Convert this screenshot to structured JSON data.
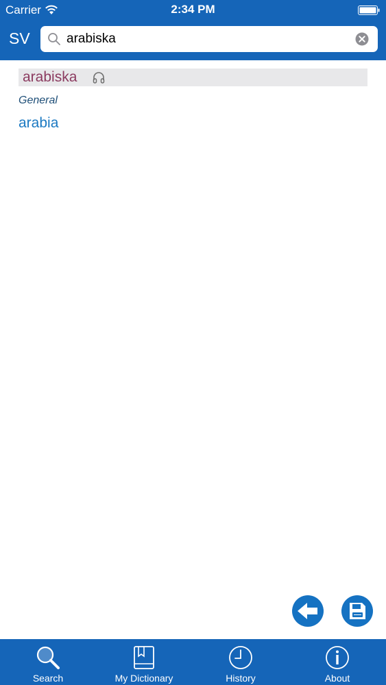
{
  "status_bar": {
    "carrier": "Carrier",
    "time": "2:34 PM"
  },
  "search_bar": {
    "language": "SV",
    "query": "arabiska",
    "placeholder": ""
  },
  "entry": {
    "headword": "arabiska",
    "category": "General",
    "translations": [
      "arabia"
    ]
  },
  "tabs": [
    {
      "label": "Search",
      "icon": "search-icon"
    },
    {
      "label": "My Dictionary",
      "icon": "book-icon"
    },
    {
      "label": "History",
      "icon": "clock-icon"
    },
    {
      "label": "About",
      "icon": "info-icon"
    }
  ],
  "colors": {
    "brand_blue": "#1565b8",
    "headword": "#8b3a5f",
    "translation": "#1b79c2",
    "category": "#1f4f78",
    "headword_bg": "#e8e8ea"
  }
}
